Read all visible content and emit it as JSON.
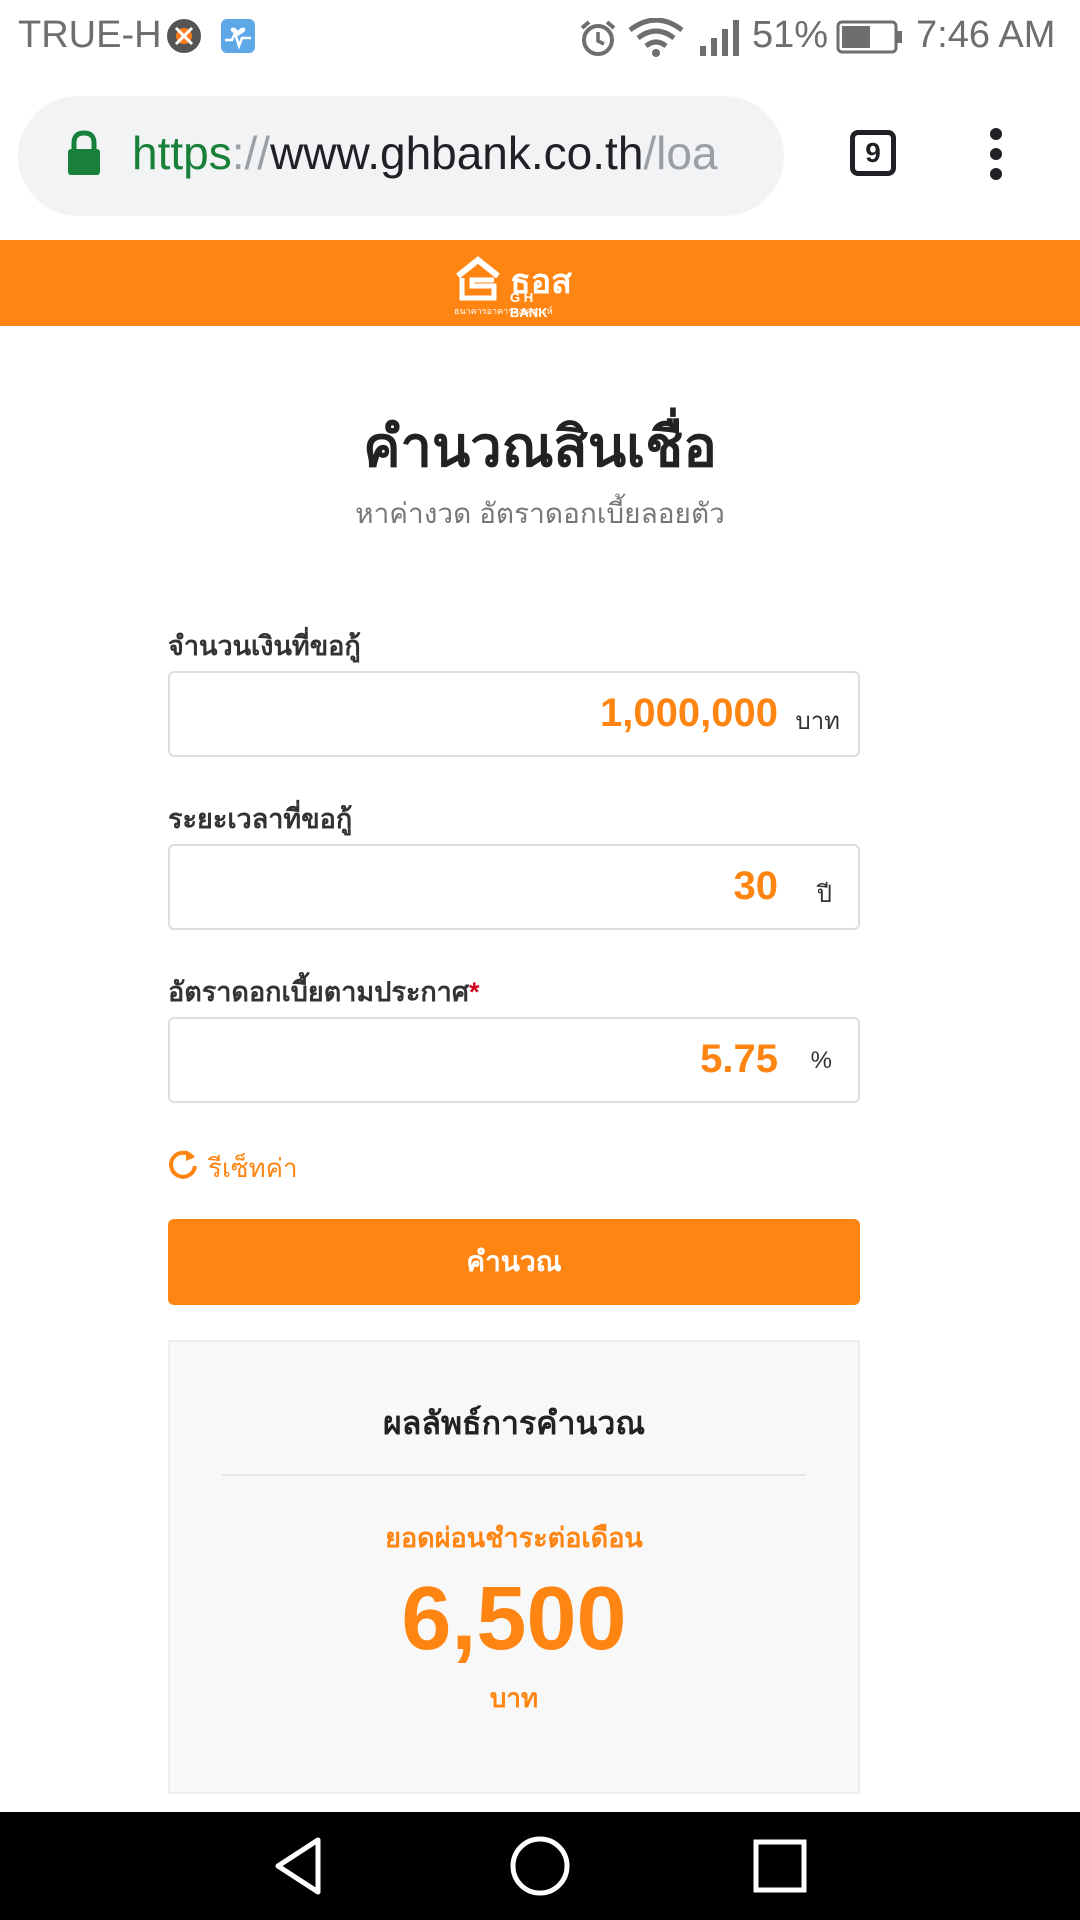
{
  "status_bar": {
    "carrier": "TRUE-H",
    "battery": "51%",
    "time": "7:46 AM",
    "icons": [
      "bug-icon",
      "health-icon",
      "alarm-icon",
      "wifi-icon",
      "signal-icon",
      "battery-icon"
    ]
  },
  "browser": {
    "url_scheme": "https",
    "url_sep": "://",
    "url_host": "www.ghbank.co.th",
    "url_path": "/loa",
    "tab_count": "9"
  },
  "header": {
    "logo_th": "ธอส",
    "logo_en": "G H BANK",
    "logo_sub": "ธนาคารอาคารสงเคราะห์"
  },
  "page": {
    "title": "คำนวณสินเชื่อ",
    "subtitle": "หาค่างวด อัตราดอกเบี้ยลอยตัว"
  },
  "form": {
    "amount": {
      "label": "จำนวนเงินที่ขอกู้",
      "value": "1,000,000",
      "unit": "บาท"
    },
    "term": {
      "label": "ระยะเวลาที่ขอกู้",
      "value": "30",
      "unit": "ปี"
    },
    "rate": {
      "label": "อัตราดอกเบี้ยตามประกาศ",
      "required_mark": "*",
      "value": "5.75",
      "unit": "%"
    },
    "reset_label": "รีเซ็ทค่า",
    "calculate_label": "คำนวณ"
  },
  "result": {
    "title": "ผลลัพธ์การคำนวณ",
    "label": "ยอดผ่อนชำระต่อเดือน",
    "value": "6,500",
    "unit": "บาท"
  },
  "colors": {
    "accent": "#ff8512",
    "url_scheme": "#188038",
    "required": "#d0021b"
  }
}
